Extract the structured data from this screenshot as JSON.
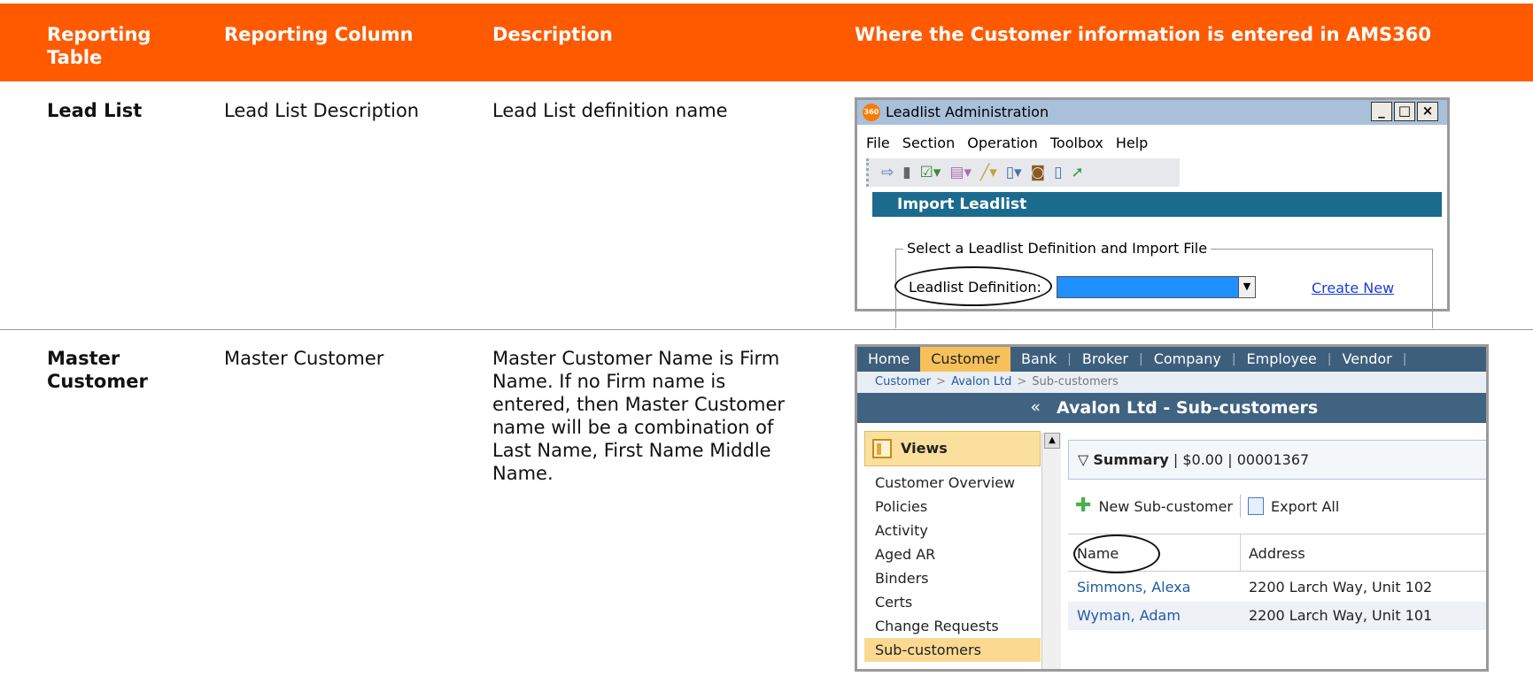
{
  "header": {
    "col1": "Reporting Table",
    "col2": "Reporting Column",
    "col3": "Description",
    "col4": "Where the Customer information is entered in AMS360"
  },
  "colors": {
    "header_bg": "#ff5a00",
    "header_text": "#ffffff"
  },
  "rows": [
    {
      "table": "Lead List",
      "column": "Lead List Description",
      "description": "Lead List definition name"
    },
    {
      "table": "Master Customer",
      "column": "Master Customer",
      "description": "Master Customer Name is Firm Name. If no Firm name is entered, then Master Customer name will be a combination of Last Name, First Name Middle Name."
    }
  ],
  "shot1": {
    "logo": "360",
    "title": "Leadlist Administration",
    "window_controls": [
      "_",
      "□",
      "×"
    ],
    "menu": [
      "File",
      "Section",
      "Operation",
      "Toolbox",
      "Help"
    ],
    "toolbar_icons": [
      "import-icon",
      "phone-icon",
      "checklist-icon",
      "book-icon",
      "pen-icon",
      "document-icon",
      "binoculars-icon",
      "page-icon",
      "exit-icon"
    ],
    "section_title": "Import Leadlist",
    "group_legend": "Select a Leadlist Definition and Import File",
    "field_label": "Leadlist Definition:",
    "create_new": "Create New"
  },
  "shot2": {
    "nav": [
      "Home",
      "Customer",
      "Bank",
      "Broker",
      "Company",
      "Employee",
      "Vendor"
    ],
    "nav_active": "Customer",
    "breadcrumb": [
      "Customer",
      "Avalon Ltd",
      "Sub-customers"
    ],
    "collapse": "«",
    "views_label": "Views",
    "menu": [
      "Customer Overview",
      "Policies",
      "Activity",
      "Aged AR",
      "Binders",
      "Certs",
      "Change Requests",
      "Sub-customers"
    ],
    "menu_active": "Sub-customers",
    "main_title": "Avalon Ltd - Sub-customers",
    "summary_label": "Summary",
    "summary_amount": "$0.00",
    "summary_id": "00001367",
    "new_label": "New Sub-customer",
    "export_label": "Export All",
    "columns": [
      "Name",
      "Address"
    ],
    "rows": [
      {
        "name": "Simmons, Alexa",
        "address": "2200 Larch Way, Unit 102"
      },
      {
        "name": "Wyman, Adam",
        "address": "2200 Larch Way, Unit 101"
      }
    ]
  }
}
